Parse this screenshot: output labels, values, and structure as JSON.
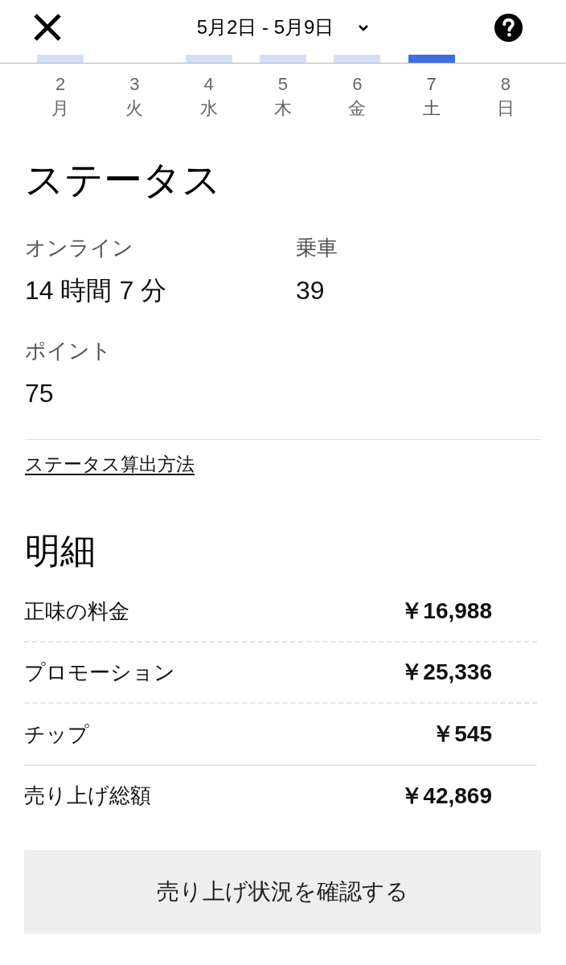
{
  "header": {
    "title": "5月2日 - 5月9日"
  },
  "days": [
    {
      "number": "2",
      "weekday": "月",
      "bar": true,
      "selected": false
    },
    {
      "number": "3",
      "weekday": "火",
      "bar": false,
      "selected": false
    },
    {
      "number": "4",
      "weekday": "水",
      "bar": true,
      "selected": false
    },
    {
      "number": "5",
      "weekday": "木",
      "bar": true,
      "selected": false
    },
    {
      "number": "6",
      "weekday": "金",
      "bar": true,
      "selected": false
    },
    {
      "number": "7",
      "weekday": "土",
      "bar": true,
      "selected": true
    },
    {
      "number": "8",
      "weekday": "日",
      "bar": false,
      "selected": false
    }
  ],
  "status": {
    "title": "ステータス",
    "stats": [
      {
        "label": "オンライン",
        "value": "14 時間 7 分"
      },
      {
        "label": "乗車",
        "value": "39"
      },
      {
        "label": "ポイント",
        "value": "75"
      }
    ],
    "link": "ステータス算出方法"
  },
  "breakdown": {
    "title": "明細",
    "rows": [
      {
        "kind": "item",
        "label": "正味の料金",
        "amount": "￥16,988"
      },
      {
        "kind": "item",
        "label": "プロモーション",
        "amount": "￥25,336"
      },
      {
        "kind": "item",
        "label": "チップ",
        "amount": "￥545"
      },
      {
        "kind": "total",
        "label": "売り上げ総額",
        "amount": "￥42,869"
      }
    ]
  },
  "button": "売り上げ状況を確認する"
}
